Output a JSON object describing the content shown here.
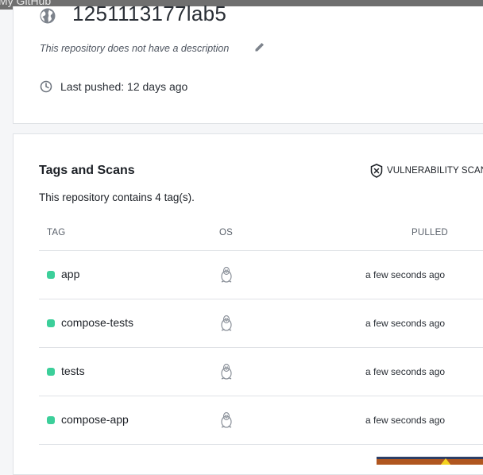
{
  "window": {
    "title": "My GitHub"
  },
  "repo": {
    "name": "1251113177lab5",
    "description": "This repository does not have a description",
    "last_pushed": "Last pushed: 12 days ago"
  },
  "tags_section": {
    "title": "Tags and Scans",
    "vulnerability_label": "VULNERABILITY SCAN",
    "count_text": "This repository contains 4 tag(s).",
    "columns": {
      "tag": "TAG",
      "os": "OS",
      "pulled": "PULLED"
    },
    "rows": [
      {
        "tag": "app",
        "os_icon": "linux-penguin-icon",
        "pulled": "a few seconds ago"
      },
      {
        "tag": "compose-tests",
        "os_icon": "linux-penguin-icon",
        "pulled": "a few seconds ago"
      },
      {
        "tag": "tests",
        "os_icon": "linux-penguin-icon",
        "pulled": "a few seconds ago"
      },
      {
        "tag": "compose-app",
        "os_icon": "linux-penguin-icon",
        "pulled": "a few seconds ago"
      }
    ]
  },
  "colors": {
    "status_active": "#3ccf9a",
    "card_border": "#dfe2e6",
    "page_bg": "#f5f6f8"
  }
}
